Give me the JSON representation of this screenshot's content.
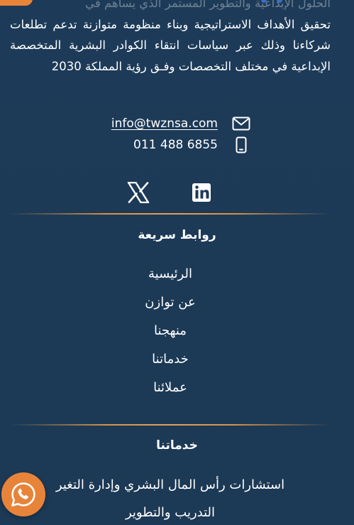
{
  "about": {
    "line_faded": "الحلول الإبداعية والتطوير المستمر الذي يساهم في",
    "line_1": "تحقيق الأهداف الاستراتيجية وبناء منظومة متوازنة تدعم",
    "line_2": "تطلعات شركاءنا وذلك عبر سياسات انتقاء الكوادر",
    "line_3": "البشرية المتخصصة الإبداعية في مختلف التخصصات",
    "line_4": "وفـق رؤية المملكة 2030"
  },
  "contact": {
    "email": "info@twznsa.com",
    "phone": "011 488 6855",
    "email_icon": "envelope-icon",
    "phone_icon": "mobile-phone-icon"
  },
  "social": {
    "x_icon": "x-twitter-icon",
    "linkedin_icon": "linkedin-icon"
  },
  "quick_links": {
    "title": "روابط سريعة",
    "items": [
      "الرئيسية",
      "عن توازن",
      "منهجنا",
      "خدماتنا",
      "عملائنا"
    ]
  },
  "services": {
    "title": "خدماتنا",
    "items": [
      "استشارات رأس المال البشري وإدارة التغير",
      "التدريب والتطوير"
    ]
  },
  "whatsapp": {
    "icon": "whatsapp-icon"
  },
  "colors": {
    "background": "#1c3a57",
    "accent": "#e8843a",
    "divider": "#d69246"
  }
}
